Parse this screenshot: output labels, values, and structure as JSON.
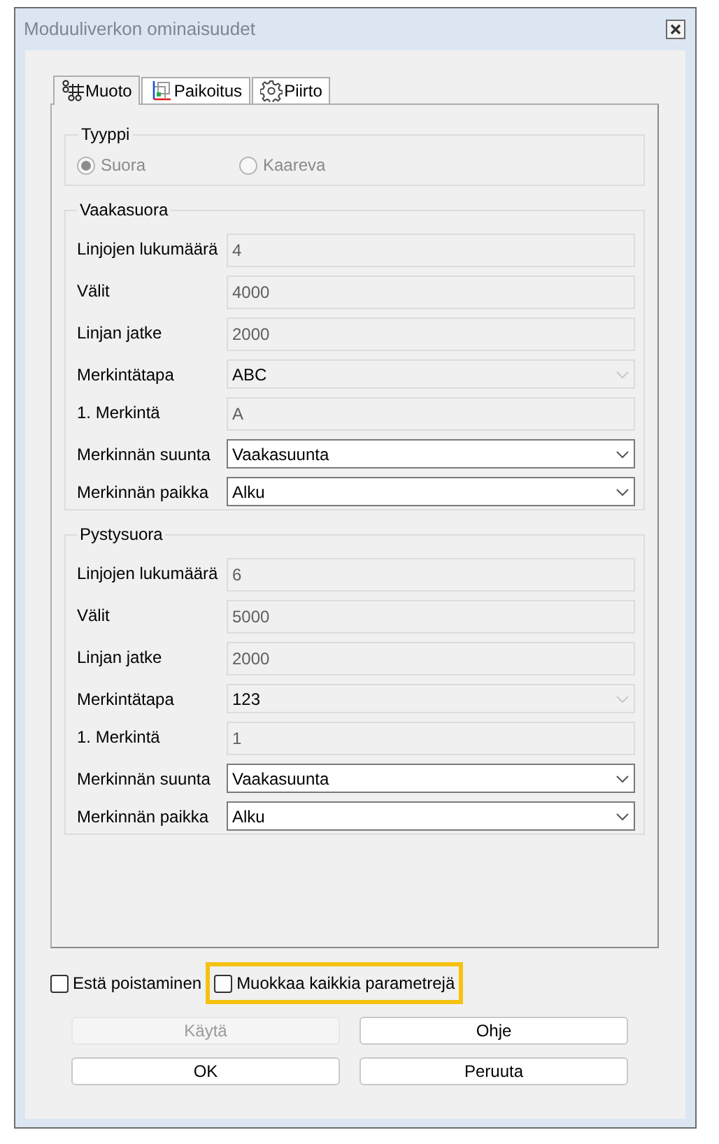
{
  "window": {
    "title": "Moduuliverkon ominaisuudet"
  },
  "tabs": [
    {
      "label": "Muoto",
      "selected": true
    },
    {
      "label": "Paikoitus",
      "selected": false
    },
    {
      "label": "Piirto",
      "selected": false
    }
  ],
  "type_group": {
    "title": "Tyyppi",
    "options": [
      {
        "label": "Suora",
        "selected": true,
        "disabled": true
      },
      {
        "label": "Kaareva",
        "selected": false,
        "disabled": true
      }
    ]
  },
  "groups": [
    {
      "title": "Vaakasuora",
      "fields": [
        {
          "label": "Linjojen lukumäärä",
          "kind": "text",
          "value": "4",
          "disabled": true
        },
        {
          "label": "Välit",
          "kind": "text",
          "value": "4000",
          "disabled": true
        },
        {
          "label": "Linjan jatke",
          "kind": "text",
          "value": "2000",
          "disabled": true
        },
        {
          "label": "Merkintätapa",
          "kind": "select",
          "value": "ABC",
          "disabled": true
        },
        {
          "label": "1. Merkintä",
          "kind": "text",
          "value": "A",
          "disabled": true
        },
        {
          "label": "Merkinnän suunta",
          "kind": "select",
          "value": "Vaakasuunta",
          "disabled": false
        },
        {
          "label": "Merkinnän paikka",
          "kind": "select",
          "value": "Alku",
          "disabled": false
        }
      ]
    },
    {
      "title": "Pystysuora",
      "fields": [
        {
          "label": "Linjojen lukumäärä",
          "kind": "text",
          "value": "6",
          "disabled": true
        },
        {
          "label": "Välit",
          "kind": "text",
          "value": "5000",
          "disabled": true
        },
        {
          "label": "Linjan jatke",
          "kind": "text",
          "value": "2000",
          "disabled": true
        },
        {
          "label": "Merkintätapa",
          "kind": "select",
          "value": "123",
          "disabled": true
        },
        {
          "label": "1. Merkintä",
          "kind": "text",
          "value": "1",
          "disabled": true
        },
        {
          "label": "Merkinnän suunta",
          "kind": "select",
          "value": "Vaakasuunta",
          "disabled": false
        },
        {
          "label": "Merkinnän paikka",
          "kind": "select",
          "value": "Alku",
          "disabled": false
        }
      ]
    }
  ],
  "checkboxes": [
    {
      "label": "Estä poistaminen",
      "checked": false,
      "highlighted": false
    },
    {
      "label": "Muokkaa kaikkia parametrejä",
      "checked": false,
      "highlighted": true
    }
  ],
  "buttons": [
    {
      "label": "Käytä",
      "disabled": true
    },
    {
      "label": "Ohje",
      "disabled": false
    },
    {
      "label": "OK",
      "disabled": false
    },
    {
      "label": "Peruuta",
      "disabled": false
    }
  ]
}
